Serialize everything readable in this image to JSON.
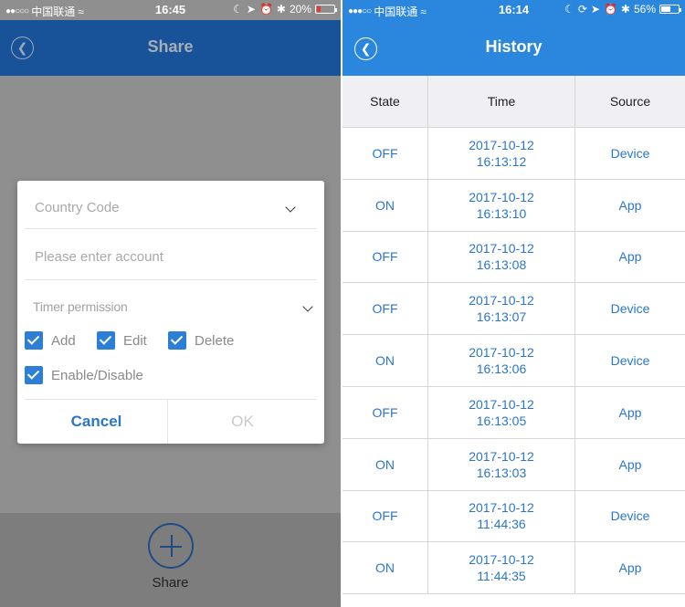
{
  "left": {
    "status": {
      "carrier": "中国联通",
      "time": "16:45",
      "battery": "20%",
      "battery_level": 0.2
    },
    "nav": {
      "title": "Share"
    },
    "dialog": {
      "country_code_placeholder": "Country Code",
      "account_placeholder": "Please enter account",
      "timer_permission_label": "Timer permission",
      "checkboxes": [
        {
          "label": "Add",
          "checked": true
        },
        {
          "label": "Edit",
          "checked": true
        },
        {
          "label": "Delete",
          "checked": true
        },
        {
          "label": "Enable/Disable",
          "checked": true
        }
      ],
      "cancel_label": "Cancel",
      "ok_label": "OK"
    },
    "share_button_label": "Share"
  },
  "right": {
    "status": {
      "carrier": "中国联通",
      "time": "16:14",
      "battery": "56%",
      "battery_level": 0.56
    },
    "nav": {
      "title": "History"
    },
    "columns": [
      "State",
      "Time",
      "Source"
    ],
    "rows": [
      {
        "state": "OFF",
        "date": "2017-10-12",
        "time": "16:13:12",
        "source": "Device"
      },
      {
        "state": "ON",
        "date": "2017-10-12",
        "time": "16:13:10",
        "source": "App"
      },
      {
        "state": "OFF",
        "date": "2017-10-12",
        "time": "16:13:08",
        "source": "App"
      },
      {
        "state": "OFF",
        "date": "2017-10-12",
        "time": "16:13:07",
        "source": "Device"
      },
      {
        "state": "ON",
        "date": "2017-10-12",
        "time": "16:13:06",
        "source": "Device"
      },
      {
        "state": "OFF",
        "date": "2017-10-12",
        "time": "16:13:05",
        "source": "App"
      },
      {
        "state": "ON",
        "date": "2017-10-12",
        "time": "16:13:03",
        "source": "App"
      },
      {
        "state": "OFF",
        "date": "2017-10-12",
        "time": "11:44:36",
        "source": "Device"
      },
      {
        "state": "ON",
        "date": "2017-10-12",
        "time": "11:44:35",
        "source": "App"
      }
    ]
  },
  "colors": {
    "nav_left": "#18539a",
    "nav_right": "#2b86de",
    "accent_text": "#2b76c8",
    "checkbox": "#2c7fd6"
  }
}
